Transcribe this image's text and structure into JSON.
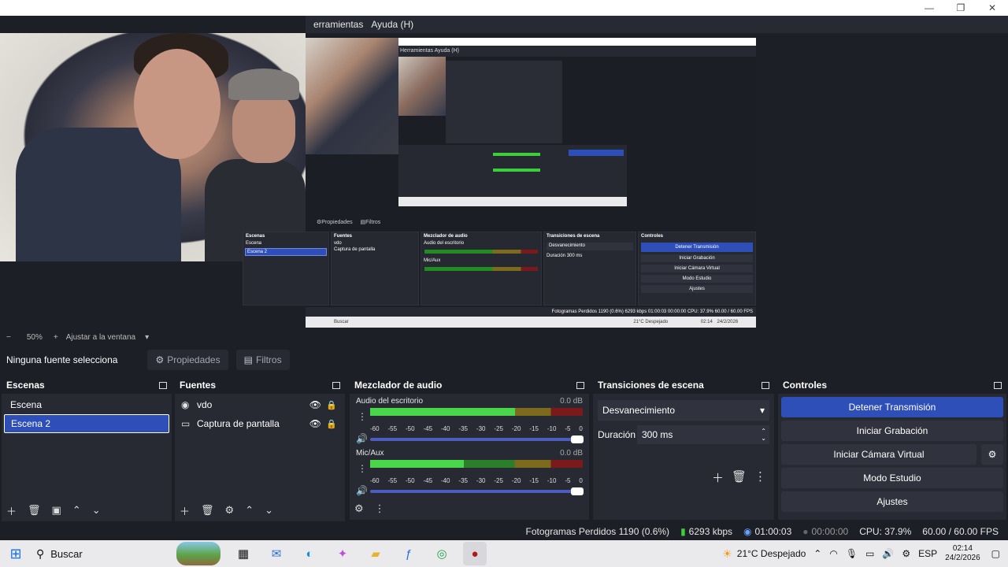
{
  "window": {
    "minimize": "—",
    "maximize": "❐",
    "close": "✕"
  },
  "menubar": {
    "items": [
      "erramientas",
      "Ayuda (H)"
    ]
  },
  "preview_nested": {
    "menu": "Herramientas   Ayuda (H)",
    "properties": "⚙Propiedades",
    "filters": "▤Filtros",
    "scenes_title": "Escenas",
    "sources_title": "Fuentes",
    "mixer_title": "Mezclador de audio",
    "transitions_title": "Transiciones de escena",
    "controls_title": "Controles",
    "scene1": "Escena",
    "scene2": "Escena 2",
    "src1": "vdo",
    "src2": "Captura de pantalla",
    "mix1": "Audio del escritorio",
    "mix2": "Mic/Aux",
    "trans": "Desvanecimiento",
    "dur": "Duración",
    "dur_val": "300 ms",
    "btn1": "Detener Transmisión",
    "btn2": "Iniciar Grabación",
    "btn3": "Iniciar Cámara Virtual",
    "btn4": "Modo Estudio",
    "btn5": "Ajustes",
    "status": "Fotogramas Perdidos 1190 (0.6%)   6293 kbps   01:00:03   00:00:00   CPU: 37.9%   60.00 / 60.00 FPS",
    "task_search": "Buscar",
    "task_weather": "21°C  Despejado",
    "task_time": "02:14",
    "task_date": "24/2/2026"
  },
  "zoom": {
    "minus": "−",
    "value": "50%",
    "plus": "+",
    "fit": "Ajustar a la ventana",
    "caret": "▾"
  },
  "sourcebar": {
    "no_source": "Ninguna fuente selecciona",
    "properties": "Propiedades",
    "filters": "Filtros"
  },
  "scenes": {
    "title": "Escenas",
    "items": [
      "Escena",
      "Escena 2"
    ],
    "selected_index": 1
  },
  "sources": {
    "title": "Fuentes",
    "items": [
      {
        "label": "vdo",
        "icon": "camera-icon"
      },
      {
        "label": "Captura de pantalla",
        "icon": "monitor-icon"
      }
    ]
  },
  "mixer": {
    "title": "Mezclador de audio",
    "channels": [
      {
        "name": "Audio del escritorio",
        "db": "0.0 dB",
        "level_a": 0.68,
        "level_b": 0.68
      },
      {
        "name": "Mic/Aux",
        "db": "0.0 dB",
        "level_a": 0.44,
        "level_b": 0.62
      }
    ],
    "ticks": [
      "-60",
      "-55",
      "-50",
      "-45",
      "-40",
      "-35",
      "-30",
      "-25",
      "-20",
      "-15",
      "-10",
      "-5",
      "0"
    ]
  },
  "transitions": {
    "title": "Transiciones de escena",
    "selected": "Desvanecimiento",
    "duration_label": "Duración",
    "duration_value": "300 ms"
  },
  "controls": {
    "title": "Controles",
    "stop_stream": "Detener Transmisión",
    "start_record": "Iniciar Grabación",
    "start_vcam": "Iniciar Cámara Virtual",
    "studio_mode": "Modo Estudio",
    "settings": "Ajustes"
  },
  "status": {
    "dropped": "Fotogramas Perdidos 1190 (0.6%)",
    "bitrate": "6293 kbps",
    "stream_time": "01:00:03",
    "record_time": "00:00:00",
    "cpu": "CPU: 37.9%",
    "fps": "60.00 / 60.00 FPS"
  },
  "taskbar": {
    "search": "Buscar",
    "weather": "21°C  Despejado",
    "lang": "ESP",
    "time": "02:14",
    "date": "24/2/2026"
  },
  "colors": {
    "accent": "#2e4fb8",
    "panel": "#272a33",
    "background": "#1d1f26",
    "meter_green": "#4ad64a"
  }
}
